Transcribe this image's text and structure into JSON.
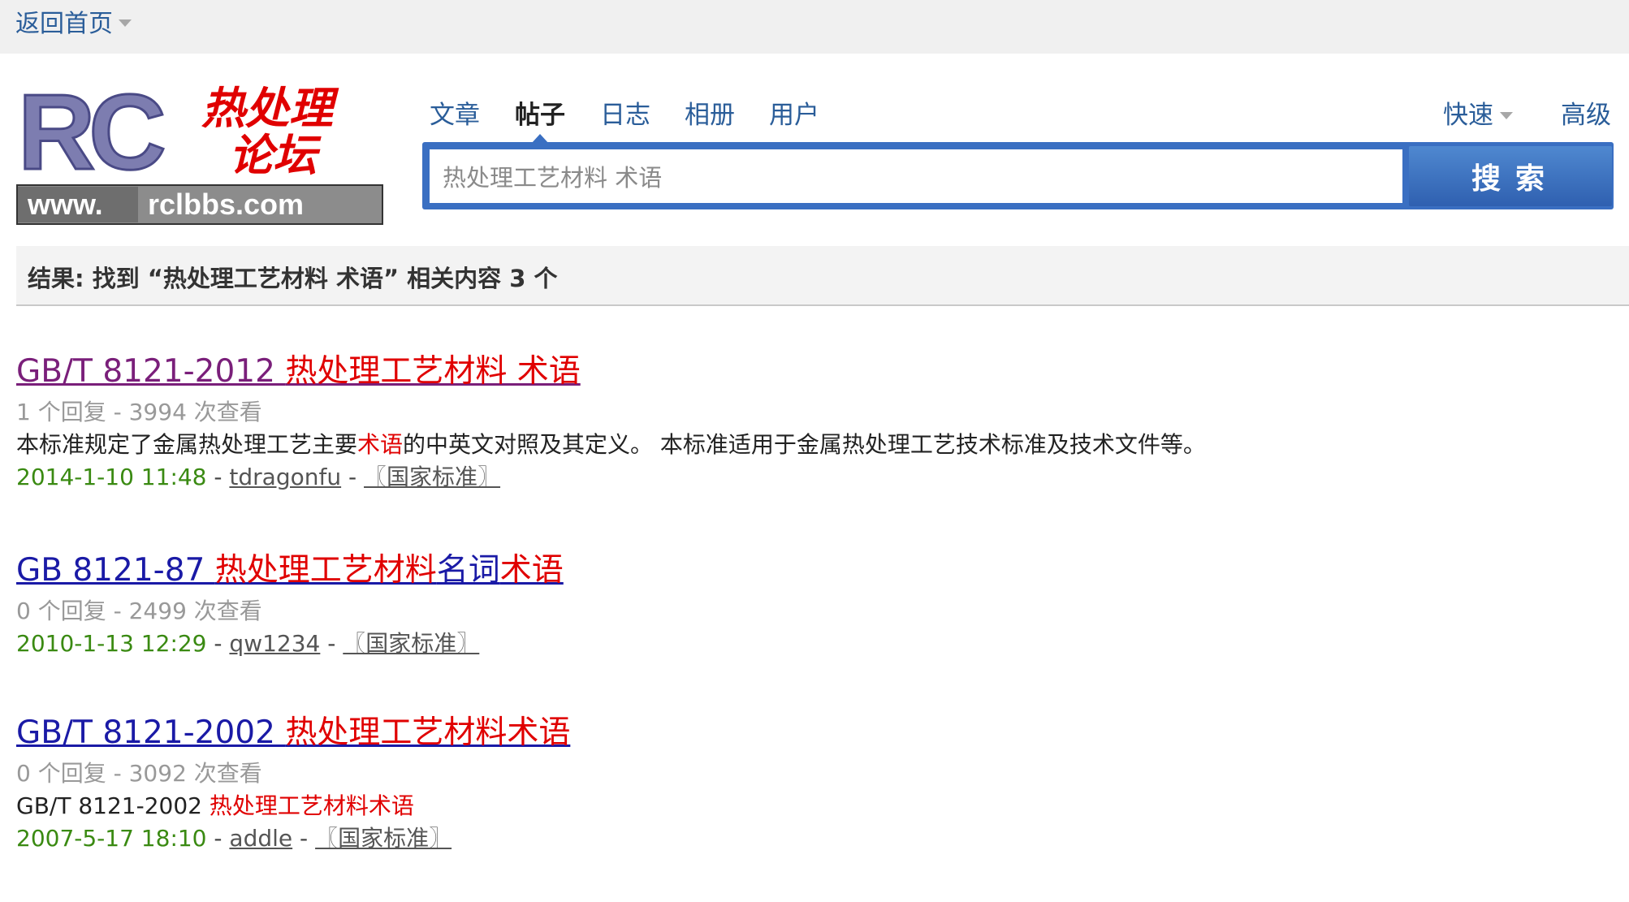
{
  "topbar": {
    "home_label": "返回首页"
  },
  "logo": {
    "letters": "RC",
    "cn_line1": "热处理",
    "cn_line2": "论坛",
    "url_prefix": "www.",
    "url_main": "rclbbs.com"
  },
  "nav": {
    "items": [
      "文章",
      "帖子",
      "日志",
      "相册",
      "用户"
    ],
    "active_index": 1,
    "quick_label": "快速",
    "advanced_label": "高级"
  },
  "search": {
    "value": "热处理工艺材料 术语",
    "button_label": "搜索"
  },
  "summary": "结果: 找到 “热处理工艺材料 术语” 相关内容 3 个",
  "results": [
    {
      "title_prefix": "GB/T 8121-2012 ",
      "title_hl1": "热处理工艺材料 术语",
      "title_mid": "",
      "title_hl2": "",
      "title_color": "#7a1f7a",
      "meta": "1 个回复 - 3994 次查看",
      "desc_prefix": "本标准规定了金属热处理工艺主要",
      "desc_hl": "术语",
      "desc_suffix": "的中英文对照及其定义。 本标准适用于金属热处理工艺技术标准及技术文件等。",
      "date": "2014-1-10 11:48",
      "user": "tdragonfu",
      "forum": "〖国家标准〗"
    },
    {
      "title_prefix": "GB 8121-87 ",
      "title_hl1": "热处理工艺材料",
      "title_mid": "名词",
      "title_hl2": "术语",
      "title_color": "#1a1aa6",
      "meta": "0 个回复 - 2499 次查看",
      "date": "2010-1-13 12:29",
      "user": "qw1234",
      "forum": "〖国家标准〗"
    },
    {
      "title_prefix": "GB/T 8121-2002 ",
      "title_hl1": "热处理工艺材料术语",
      "title_mid": "",
      "title_hl2": "",
      "title_color": "#1a1aa6",
      "meta": "0 个回复 - 3092 次查看",
      "desc_prefix": "GB/T 8121-2002 ",
      "desc_hl": "热处理工艺材料术语",
      "desc_suffix": "",
      "date": "2007-5-17 18:10",
      "user": "addle",
      "forum": "〖国家标准〗"
    }
  ],
  "colors": {
    "link_blue": "#2a5d99",
    "highlight_red": "#e00000",
    "date_green": "#3a8a12",
    "search_blue": "#3a6fc2"
  }
}
